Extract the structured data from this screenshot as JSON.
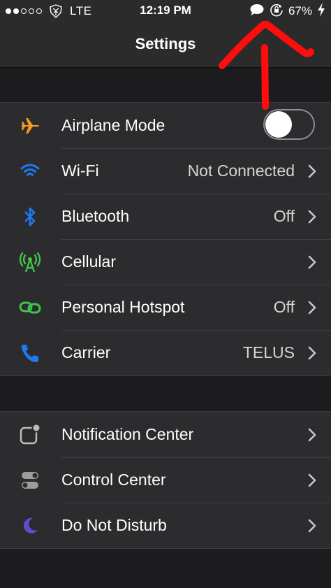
{
  "status_bar": {
    "signal_filled": 2,
    "signal_total": 5,
    "carrier_logo": "transformers-icon",
    "network": "LTE",
    "time": "12:19 PM",
    "battery_percent": "67%",
    "icons": [
      "message-bubble-icon",
      "rotation-lock-icon",
      "charging-bolt-icon"
    ]
  },
  "nav": {
    "title": "Settings"
  },
  "connectivity_group": [
    {
      "name": "airplane-mode",
      "label": "Airplane Mode",
      "icon": "airplane-icon",
      "icon_color": "#f39a25",
      "control": "toggle",
      "toggle_on": false
    },
    {
      "name": "wifi",
      "label": "Wi-Fi",
      "value": "Not Connected",
      "icon": "wifi-icon",
      "icon_color": "#1e7bf0"
    },
    {
      "name": "bluetooth",
      "label": "Bluetooth",
      "value": "Off",
      "icon": "bluetooth-icon",
      "icon_color": "#1e7bf0"
    },
    {
      "name": "cellular",
      "label": "Cellular",
      "value": "",
      "icon": "cellular-icon",
      "icon_color": "#3ec44e"
    },
    {
      "name": "personal-hotspot",
      "label": "Personal Hotspot",
      "value": "Off",
      "icon": "hotspot-icon",
      "icon_color": "#3ec44e"
    },
    {
      "name": "carrier",
      "label": "Carrier",
      "value": "TELUS",
      "icon": "phone-icon",
      "icon_color": "#1e7bf0"
    }
  ],
  "system_group": [
    {
      "name": "notification-center",
      "label": "Notification Center",
      "icon": "notification-center-icon",
      "icon_color": "#bdbdbd"
    },
    {
      "name": "control-center",
      "label": "Control Center",
      "icon": "control-center-icon",
      "icon_color": "#bdbdbd"
    },
    {
      "name": "do-not-disturb",
      "label": "Do Not Disturb",
      "icon": "moon-icon",
      "icon_color": "#5a4fd0"
    }
  ],
  "annotation": {
    "color": "#ff0d0d",
    "shape": "red-hand-drawn-arrow"
  }
}
